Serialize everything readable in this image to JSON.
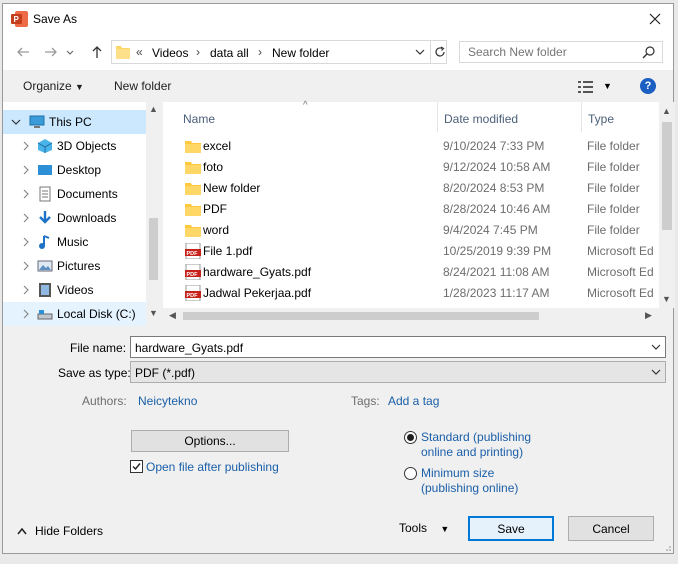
{
  "window": {
    "title": "Save As"
  },
  "address": {
    "overflow": "«",
    "crumbs": [
      "Videos",
      "data all",
      "New folder"
    ]
  },
  "search": {
    "placeholder": "Search New folder"
  },
  "toolbar": {
    "organize": "Organize",
    "new_folder": "New folder",
    "help": "?"
  },
  "tree": [
    {
      "label": "This PC"
    },
    {
      "label": "3D Objects"
    },
    {
      "label": "Desktop"
    },
    {
      "label": "Documents"
    },
    {
      "label": "Downloads"
    },
    {
      "label": "Music"
    },
    {
      "label": "Pictures"
    },
    {
      "label": "Videos"
    },
    {
      "label": "Local Disk (C:)"
    }
  ],
  "columns": {
    "name": "Name",
    "date": "Date modified",
    "type": "Type"
  },
  "files": [
    {
      "name": "excel",
      "date": "9/10/2024 7:33 PM",
      "type": "File folder",
      "icon": "folder-icon"
    },
    {
      "name": "foto",
      "date": "9/12/2024 10:58 AM",
      "type": "File folder",
      "icon": "folder-icon"
    },
    {
      "name": "New folder",
      "date": "8/20/2024 8:53 PM",
      "type": "File folder",
      "icon": "folder-icon"
    },
    {
      "name": "PDF",
      "date": "8/28/2024 10:46 AM",
      "type": "File folder",
      "icon": "folder-icon"
    },
    {
      "name": "word",
      "date": "9/4/2024 7:45 PM",
      "type": "File folder",
      "icon": "folder-icon"
    },
    {
      "name": "File 1.pdf",
      "date": "10/25/2019 9:39 PM",
      "type": "Microsoft Ed",
      "icon": "pdf-icon"
    },
    {
      "name": "hardware_Gyats.pdf",
      "date": "8/24/2021 11:08 AM",
      "type": "Microsoft Ed",
      "icon": "pdf-icon"
    },
    {
      "name": "Jadwal Pekerjaa.pdf",
      "date": "1/28/2023 11:17 AM",
      "type": "Microsoft Ed",
      "icon": "pdf-icon"
    }
  ],
  "form": {
    "filename_label": "File name:",
    "filename_value": "hardware_Gyats.pdf",
    "savetype_label": "Save as type:",
    "savetype_value": "PDF (*.pdf)",
    "authors_label": "Authors:",
    "authors_value": "Neicytekno",
    "tags_label": "Tags:",
    "tags_value": "Add a tag"
  },
  "options": {
    "options_button": "Options...",
    "open_after": "Open file after publishing",
    "open_after_checked": true,
    "standard_line1": "Standard (publishing",
    "standard_line2": "online and printing)",
    "minimum_line1": "Minimum size",
    "minimum_line2": "(publishing online)",
    "selected": "standard"
  },
  "footer": {
    "hide_folders": "Hide Folders",
    "tools": "Tools",
    "save": "Save",
    "cancel": "Cancel"
  },
  "colors": {
    "accent": "#0078d7",
    "link": "#1a5fa8",
    "selection": "#cce8ff",
    "folder": "#ffd767"
  }
}
